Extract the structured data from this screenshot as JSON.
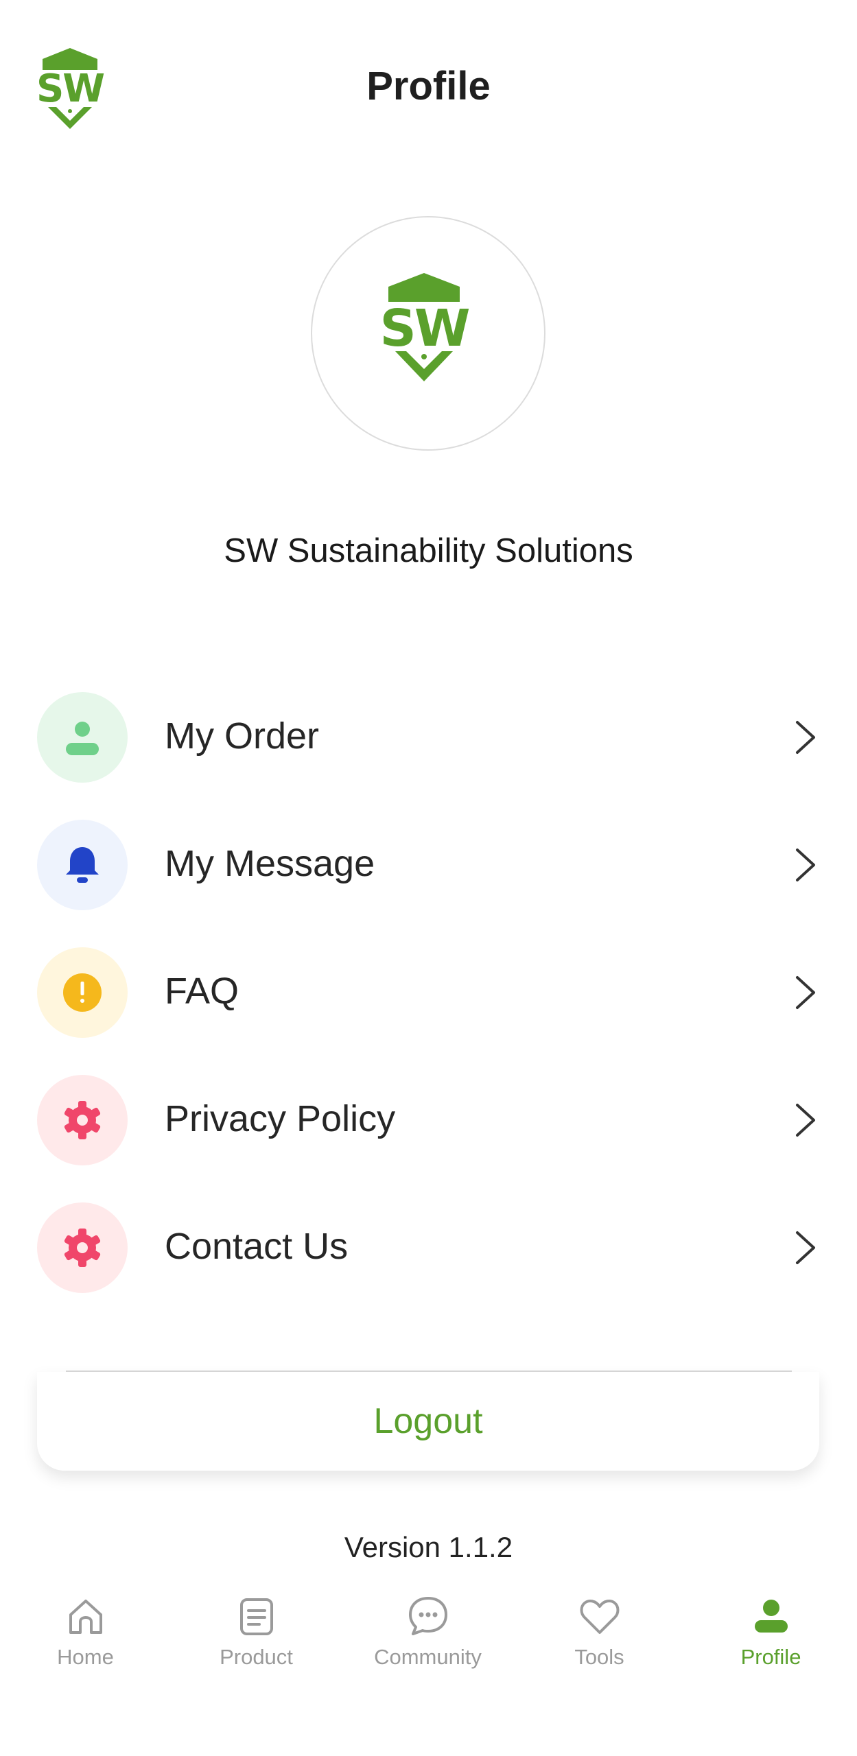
{
  "header": {
    "title": "Profile",
    "logo_icon": "sw-shield-logo-icon"
  },
  "profile": {
    "avatar_icon": "sw-shield-logo-icon",
    "company_name": "SW Sustainability Solutions"
  },
  "menu": {
    "items": [
      {
        "label": "My Order",
        "icon": "person-icon",
        "icon_color": "#6fd08a",
        "bg_color": "#e6f7ea"
      },
      {
        "label": "My Message",
        "icon": "bell-icon",
        "icon_color": "#2244c8",
        "bg_color": "#eef3fd"
      },
      {
        "label": "FAQ",
        "icon": "exclamation-icon",
        "icon_color": "#f5b81c",
        "bg_color": "#fff6dd"
      },
      {
        "label": "Privacy Policy",
        "icon": "gear-icon",
        "icon_color": "#f0466a",
        "bg_color": "#ffe9ea"
      },
      {
        "label": "Contact Us",
        "icon": "gear-icon",
        "icon_color": "#f0466a",
        "bg_color": "#ffe9ea"
      }
    ]
  },
  "logout_label": "Logout",
  "version": "Version 1.1.2",
  "bottom_nav": {
    "items": [
      {
        "label": "Home",
        "icon": "home-icon"
      },
      {
        "label": "Product",
        "icon": "document-icon"
      },
      {
        "label": "Community",
        "icon": "chat-bubble-icon"
      },
      {
        "label": "Tools",
        "icon": "heart-icon"
      },
      {
        "label": "Profile",
        "icon": "person-icon",
        "active": true
      }
    ]
  },
  "colors": {
    "brand_green": "#5aa02c",
    "inactive_nav": "#9a9a9a"
  }
}
